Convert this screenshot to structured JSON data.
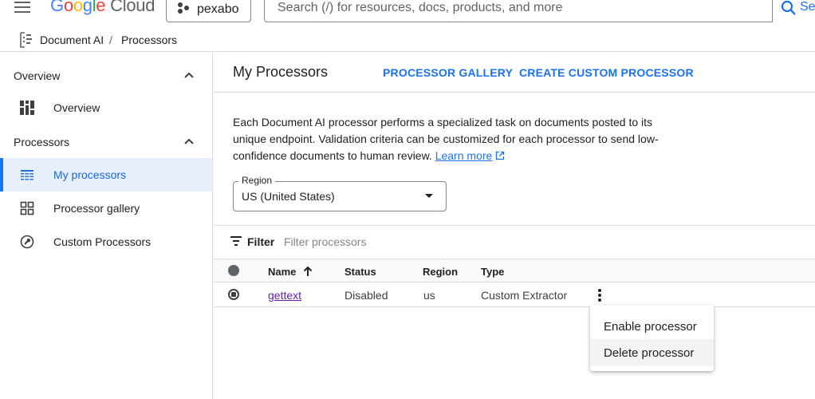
{
  "topbar": {
    "logo": {
      "google": [
        "G",
        "o",
        "o",
        "g",
        "l",
        "e"
      ],
      "cloud": "Cloud"
    },
    "project": "pexabo",
    "search_placeholder": "Search (/) for resources, docs, products, and more",
    "search_button": "Se"
  },
  "breadcrumb": {
    "product": "Document AI",
    "separator": "/",
    "page": "Processors"
  },
  "sidebar": {
    "section_overview": "Overview",
    "overview_item": "Overview",
    "section_processors": "Processors",
    "items": [
      {
        "label": "My processors",
        "icon": "list-icon"
      },
      {
        "label": "Processor gallery",
        "icon": "grid-icon"
      },
      {
        "label": "Custom Processors",
        "icon": "wrench-icon"
      }
    ]
  },
  "main": {
    "title": "My Processors",
    "tab_gallery": "PROCESSOR GALLERY",
    "tab_custom": "CREATE CUSTOM PROCESSOR",
    "description": "Each Document AI processor performs a specialized task on documents posted to its unique endpoint. Validation criteria can be customized for each processor to send low-confidence documents to human review.",
    "learn_more": "Learn more",
    "region_label": "Region",
    "region_value": "US (United States)",
    "filter_label": "Filter",
    "filter_placeholder": "Filter processors"
  },
  "table": {
    "headers": {
      "name": "Name",
      "status": "Status",
      "region": "Region",
      "type": "Type"
    },
    "rows": [
      {
        "name": "gettext",
        "status": "Disabled",
        "region": "us",
        "type": "Custom Extractor"
      }
    ]
  },
  "context_menu": {
    "items": [
      "Enable processor",
      "Delete processor"
    ]
  },
  "colors": {
    "accent": "#1a73e8",
    "link_visited": "#681da8",
    "active_bg": "#e8f0fe"
  }
}
